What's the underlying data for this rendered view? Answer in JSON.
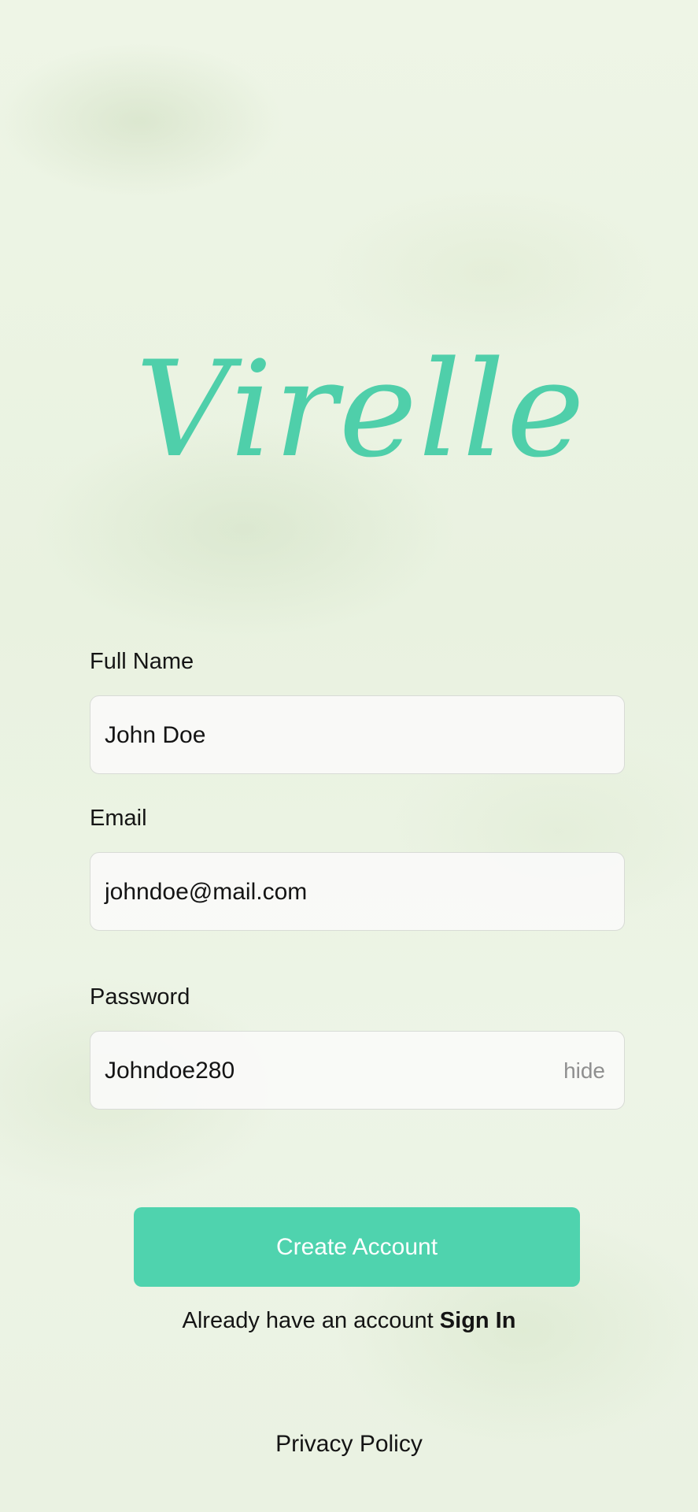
{
  "brand": {
    "logo_text": "Virelle",
    "accent_color": "#4fd3ae"
  },
  "form": {
    "full_name": {
      "label": "Full Name",
      "value": "John Doe"
    },
    "email": {
      "label": "Email",
      "value": "johndoe@mail.com"
    },
    "password": {
      "label": "Password",
      "value": "Johndoe280",
      "toggle_label": "hide"
    }
  },
  "actions": {
    "create_account_label": "Create Account",
    "signin_prompt": "Already have an account",
    "signin_link": "Sign In",
    "privacy_link": "Privacy Policy"
  }
}
